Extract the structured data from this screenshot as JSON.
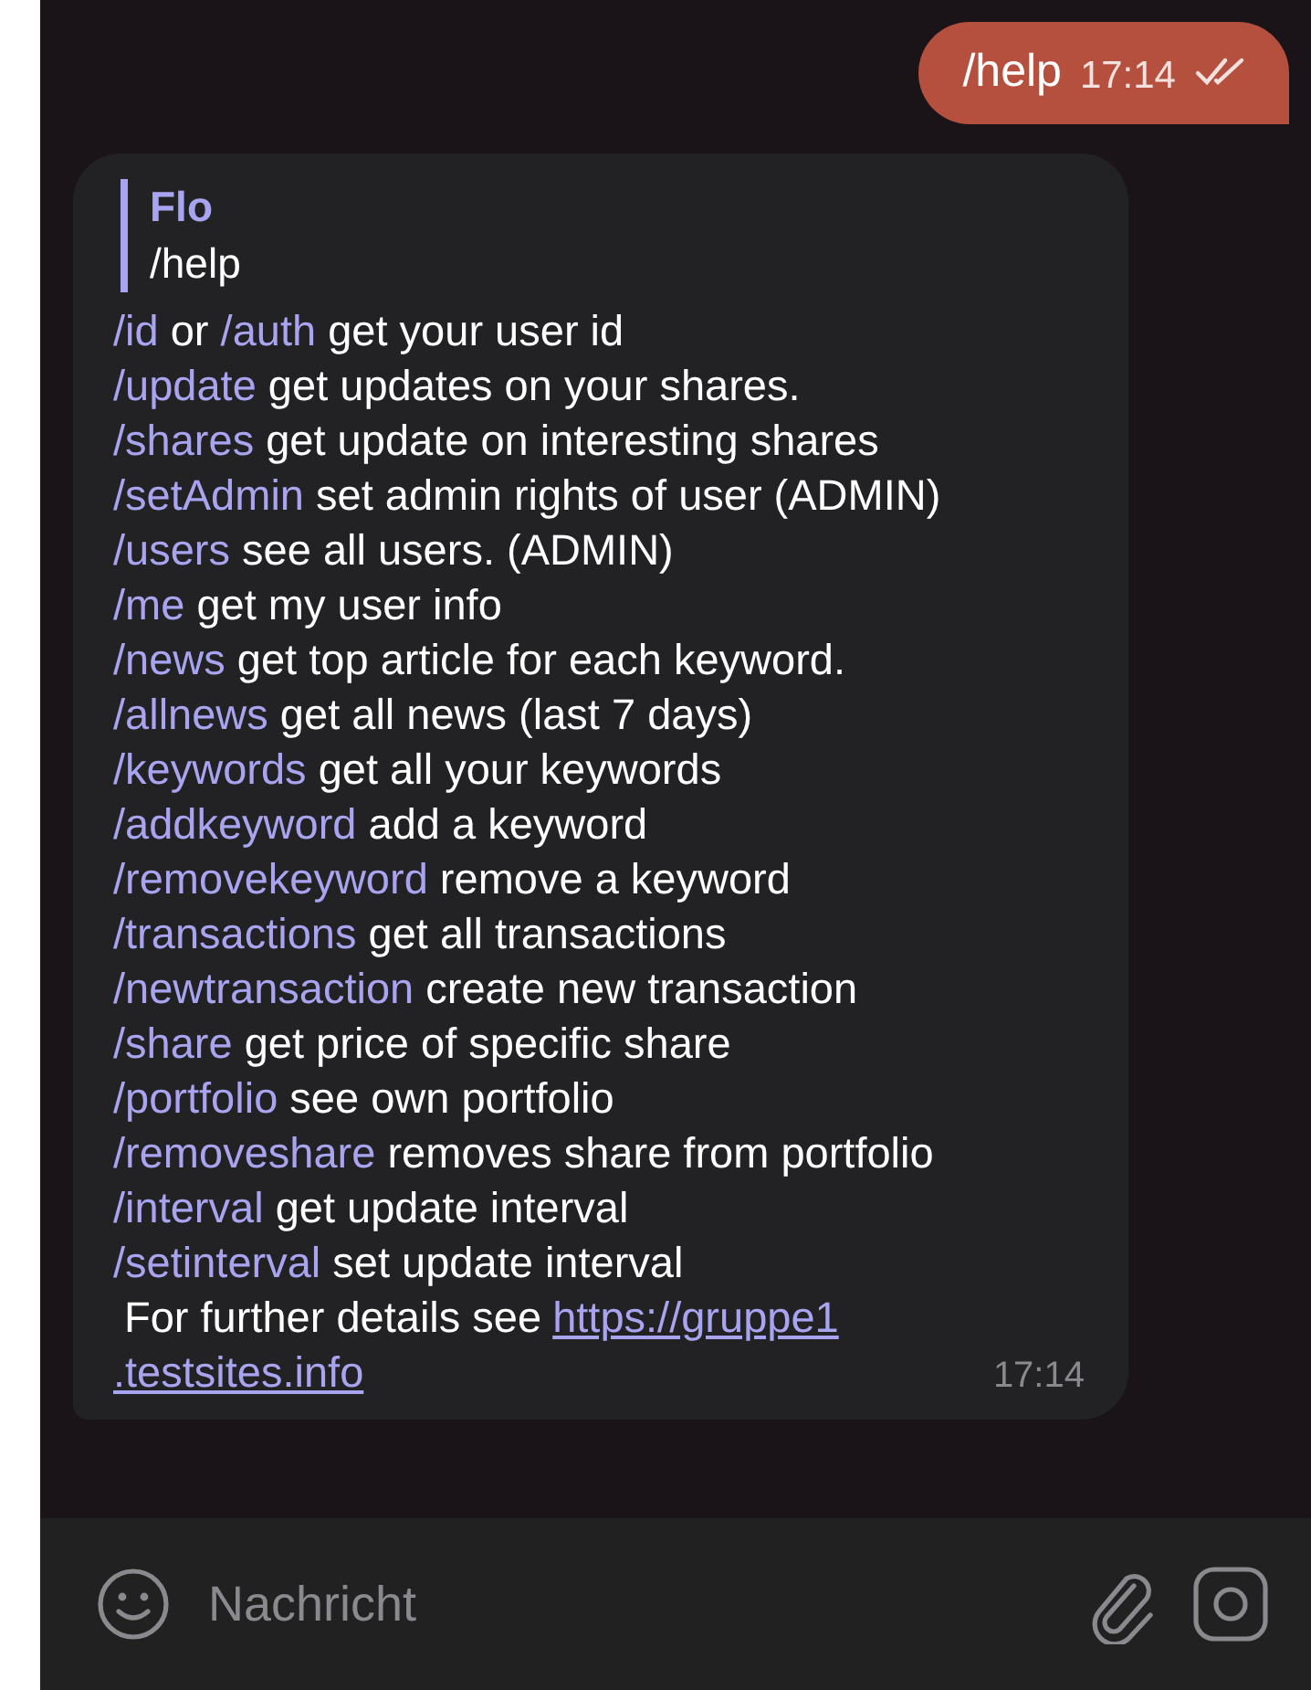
{
  "outgoing": {
    "text": "/help",
    "time": "17:14",
    "read": true
  },
  "incoming": {
    "reply": {
      "sender": "Flo",
      "text": "/help"
    },
    "lines": [
      [
        {
          "kind": "command",
          "text": "/id"
        },
        {
          "kind": "text",
          "text": " or "
        },
        {
          "kind": "command",
          "text": "/auth"
        },
        {
          "kind": "text",
          "text": " get your user id"
        }
      ],
      [
        {
          "kind": "command",
          "text": "/update"
        },
        {
          "kind": "text",
          "text": " get updates on your shares."
        }
      ],
      [
        {
          "kind": "command",
          "text": "/shares"
        },
        {
          "kind": "text",
          "text": " get update on interesting shares"
        }
      ],
      [
        {
          "kind": "command",
          "text": "/setAdmin"
        },
        {
          "kind": "text",
          "text": " set admin rights of user (ADMIN)"
        }
      ],
      [
        {
          "kind": "command",
          "text": "/users"
        },
        {
          "kind": "text",
          "text": " see all users. (ADMIN)"
        }
      ],
      [
        {
          "kind": "command",
          "text": "/me"
        },
        {
          "kind": "text",
          "text": " get my user info"
        }
      ],
      [
        {
          "kind": "command",
          "text": "/news"
        },
        {
          "kind": "text",
          "text": " get top article for each keyword."
        }
      ],
      [
        {
          "kind": "command",
          "text": "/allnews"
        },
        {
          "kind": "text",
          "text": " get all news (last 7 days)"
        }
      ],
      [
        {
          "kind": "command",
          "text": "/keywords"
        },
        {
          "kind": "text",
          "text": " get all your keywords"
        }
      ],
      [
        {
          "kind": "command",
          "text": "/addkeyword"
        },
        {
          "kind": "text",
          "text": " add a keyword"
        }
      ],
      [
        {
          "kind": "command",
          "text": "/removekeyword"
        },
        {
          "kind": "text",
          "text": " remove a keyword"
        }
      ],
      [
        {
          "kind": "command",
          "text": "/transactions"
        },
        {
          "kind": "text",
          "text": " get all transactions"
        }
      ],
      [
        {
          "kind": "command",
          "text": "/newtransaction"
        },
        {
          "kind": "text",
          "text": " create new transaction"
        }
      ],
      [
        {
          "kind": "command",
          "text": "/share"
        },
        {
          "kind": "text",
          "text": " get price of specific share"
        }
      ],
      [
        {
          "kind": "command",
          "text": "/portfolio"
        },
        {
          "kind": "text",
          "text": " see own portfolio"
        }
      ],
      [
        {
          "kind": "command",
          "text": "/removeshare"
        },
        {
          "kind": "text",
          "text": " removes share from portfolio"
        }
      ],
      [
        {
          "kind": "command",
          "text": "/interval"
        },
        {
          "kind": "text",
          "text": " get update interval"
        }
      ],
      [
        {
          "kind": "command",
          "text": "/setinterval"
        },
        {
          "kind": "text",
          "text": " set update interval"
        }
      ]
    ],
    "footer": {
      "text": "For further details see",
      "link_lines": [
        "https://gruppe1",
        ".testsites.info"
      ]
    },
    "time": "17:14"
  },
  "input": {
    "placeholder": "Nachricht"
  }
}
